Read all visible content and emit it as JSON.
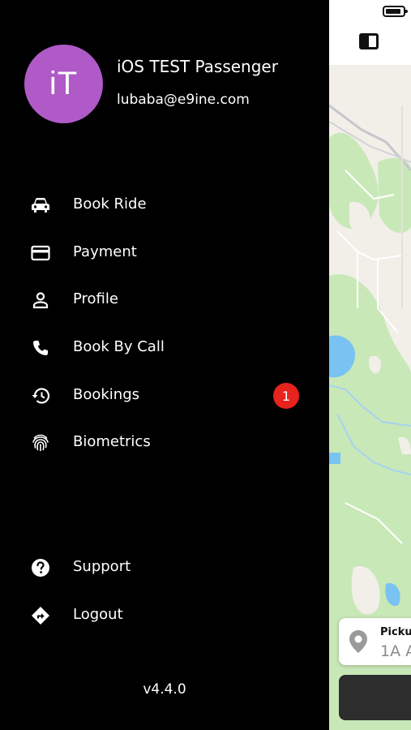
{
  "user": {
    "initials": "iT",
    "name": "iOS TEST Passenger",
    "email": "lubaba@e9ine.com",
    "avatar_color": "#b05ac8"
  },
  "menu": {
    "primary": [
      {
        "label": "Book Ride",
        "icon": "car-icon"
      },
      {
        "label": "Payment",
        "icon": "credit-card-icon"
      },
      {
        "label": "Profile",
        "icon": "person-icon"
      },
      {
        "label": "Book By Call",
        "icon": "phone-icon"
      },
      {
        "label": "Bookings",
        "icon": "history-icon",
        "badge": "1"
      },
      {
        "label": "Biometrics",
        "icon": "fingerprint-icon"
      }
    ],
    "secondary": [
      {
        "label": "Support",
        "icon": "help-circle-icon"
      },
      {
        "label": "Logout",
        "icon": "directions-icon"
      }
    ]
  },
  "version": "v4.4.0",
  "map_peek": {
    "pickup_title": "Pickup",
    "pickup_address": "1A A"
  },
  "colors": {
    "drawer_bg": "#000000",
    "badge": "#e8231d",
    "map_land": "#f2efe9",
    "map_park": "#c9e8b8",
    "map_water": "#79c3f2"
  }
}
